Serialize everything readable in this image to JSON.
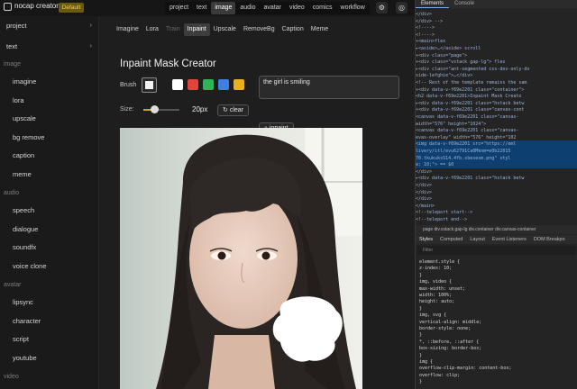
{
  "app": {
    "name": "nocap creator",
    "badge": "Default"
  },
  "topnav": [
    "project",
    "text",
    "image",
    "audio",
    "avatar",
    "video",
    "comics",
    "workflow"
  ],
  "topnav_active": "image",
  "sidebar": {
    "groups": [
      {
        "label": "project",
        "type": "expander"
      },
      {
        "label": "text",
        "type": "expander"
      }
    ],
    "sections": [
      {
        "header": "image",
        "items": [
          "imagine",
          "lora",
          "upscale",
          "bg remove",
          "caption",
          "meme"
        ]
      },
      {
        "header": "audio",
        "items": [
          "speech",
          "dialogue",
          "soundfx",
          "voice clone"
        ]
      },
      {
        "header": "avatar",
        "items": [
          "lipsync",
          "character",
          "script",
          "youtube"
        ]
      },
      {
        "header": "video",
        "items": []
      }
    ]
  },
  "tabs": [
    "Imagine",
    "Lora",
    "Train",
    "Inpaint",
    "Upscale",
    "RemoveBg",
    "Caption",
    "Meme"
  ],
  "tabs_active": "Inpaint",
  "tabs_dim": "Train",
  "page": {
    "title": "Inpaint Mask Creator",
    "brush_label": "Brush",
    "size_label": "Size:",
    "size_value": "20px",
    "clear_label": "clear",
    "inpaint_label": "inpaint",
    "prompt_value": "the girl is smiling",
    "brush_size_fraction": 0.3
  },
  "swatches": [
    "#ffffff",
    "#e0443c",
    "#2fb457",
    "#3f7fe0",
    "#e8b21f"
  ],
  "devtools": {
    "tabs": [
      "Elements",
      "Console"
    ],
    "code": [
      "      </div>",
      "    </div> -->",
      "  <!---->",
      "  <!---->",
      "  ▾<main>flex",
      "    ▸<aside>…</aside> scroll",
      "    ▾<div class=\"page\">",
      "      ▾<div class=\"vstack gap-lg\"> flex",
      "        ▸<div class=\"ant-segmented css-dev-only-do",
      "        side-lefghie\">…</div>",
      "        <!-- Rest of the template remains the sam",
      "        ▾<div data-v-f69e2201 class=\"container\">",
      "          <h2 data-v-f69e2201>Inpaint Mask Creato",
      "          ▸<div data-v-f69e2201 class=\"hstack betw",
      "          ▾<div data-v-f69e2201 class=\"canvas-cont",
      "            <canvas data-v-f69e2201 class=\"canvas-",
      "            width=\"576\" height=\"1024\">",
      "            <canvas data-v-f69e2201 class=\"canvas-",
      "            evas-overlay\" width=\"576\" height=\"102",
      "            <img data-v-f69e2201 src=\"https://eml",
      "            livery/itl/evu62791Ca0Mknm=e0b22015",
      "            70.tkukuksS14.4fb.sbesesm.png\" styl",
      "            e: 10;\"> == $0",
      "          </div>",
      "          ▸<div data-v-f69e2201 class=\"hstack betw",
      "        </div>",
      "      </div>",
      "    </div>",
      "  </main>",
      "  <!--teleport start-->",
      "  <!--teleport end-->"
    ],
    "breadcrumb": "page  div.vstack.gap-lg  div.container  div.canvas-container",
    "styles_tabs": [
      "Styles",
      "Computed",
      "Layout",
      "Event Listeners",
      "DOM Breakpo"
    ],
    "filter_placeholder": "Filter",
    "css": [
      "element.style {",
      "  z-index: 10;",
      "}",
      "img, video {",
      "  max-width: unset;",
      "  width: 100%;",
      "  height: auto;",
      "}",
      "img, svg {",
      "  vertical-align: middle;",
      "  border-style: none;",
      "}",
      "*, ::before, ::after {",
      "  box-sizing: border-box;",
      "}",
      "img {",
      "  overflow-clip-margin: content-box;",
      "  overflow: clip;",
      "}"
    ]
  }
}
